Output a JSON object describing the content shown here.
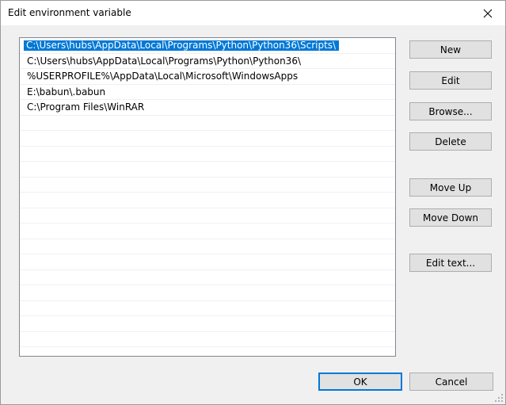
{
  "window": {
    "title": "Edit environment variable",
    "close_icon": "close-icon"
  },
  "colors": {
    "selection": "#0078d7",
    "dialog_background": "#f0f0f0",
    "list_background": "#ffffff",
    "button_background": "#e1e1e1"
  },
  "list": {
    "selected_index": 0,
    "items": [
      "C:\\Users\\hubs\\AppData\\Local\\Programs\\Python\\Python36\\Scripts\\",
      "C:\\Users\\hubs\\AppData\\Local\\Programs\\Python\\Python36\\",
      "%USERPROFILE%\\AppData\\Local\\Microsoft\\WindowsApps",
      "E:\\babun\\.babun",
      "C:\\Program Files\\WinRAR",
      "",
      "",
      "",
      "",
      "",
      "",
      "",
      "",
      "",
      "",
      "",
      "",
      "",
      "",
      "",
      ""
    ]
  },
  "buttons": {
    "new": "New",
    "edit": "Edit",
    "browse": "Browse...",
    "delete": "Delete",
    "move_up": "Move Up",
    "move_down": "Move Down",
    "edit_text": "Edit text...",
    "ok": "OK",
    "cancel": "Cancel"
  }
}
